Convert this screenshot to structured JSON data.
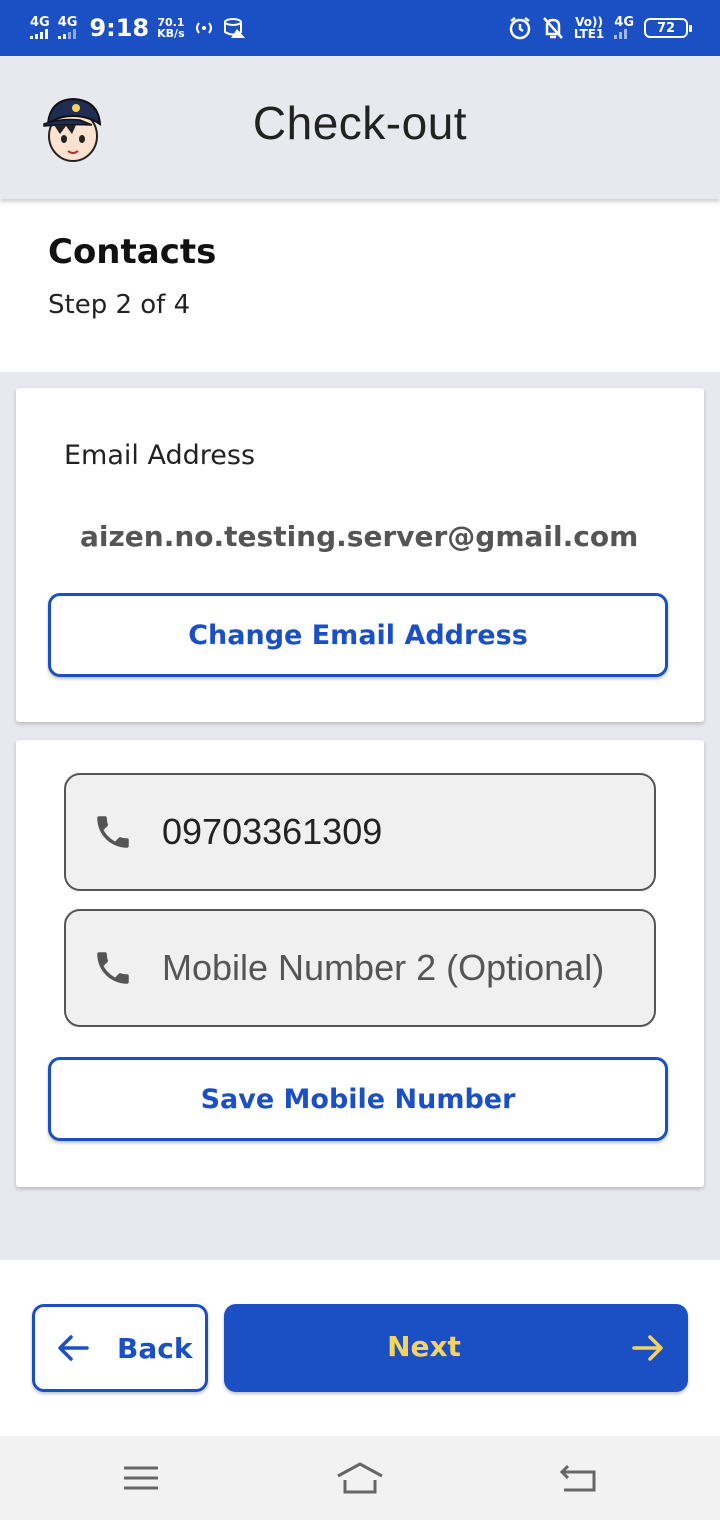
{
  "status_bar": {
    "net1": "4G",
    "net2": "4G",
    "time": "9:18",
    "speed_value": "70.1",
    "speed_unit": "KB/s",
    "volte": "Vo))",
    "lte": "LTE1",
    "net3": "4G",
    "battery": "72"
  },
  "header": {
    "title": "Check-out"
  },
  "section": {
    "title": "Contacts",
    "step": "Step 2 of 4"
  },
  "email_card": {
    "label": "Email Address",
    "value": "aizen.no.testing.server@gmail.com",
    "change_button": "Change Email Address"
  },
  "mobile_card": {
    "mobile1_value": "09703361309",
    "mobile2_placeholder": "Mobile Number 2 (Optional)",
    "save_button": "Save Mobile Number"
  },
  "footer": {
    "back_label": "Back",
    "next_label": "Next"
  },
  "colors": {
    "primary": "#1b4fc4",
    "next_text": "#f4d35e",
    "background_gray": "#e8e9ee"
  },
  "icons": [
    "avatar-icon",
    "phone-icon",
    "arrow-left-icon",
    "arrow-right-icon",
    "menu-icon",
    "home-icon",
    "back-nav-icon",
    "alarm-icon",
    "notifications-off-icon"
  ]
}
